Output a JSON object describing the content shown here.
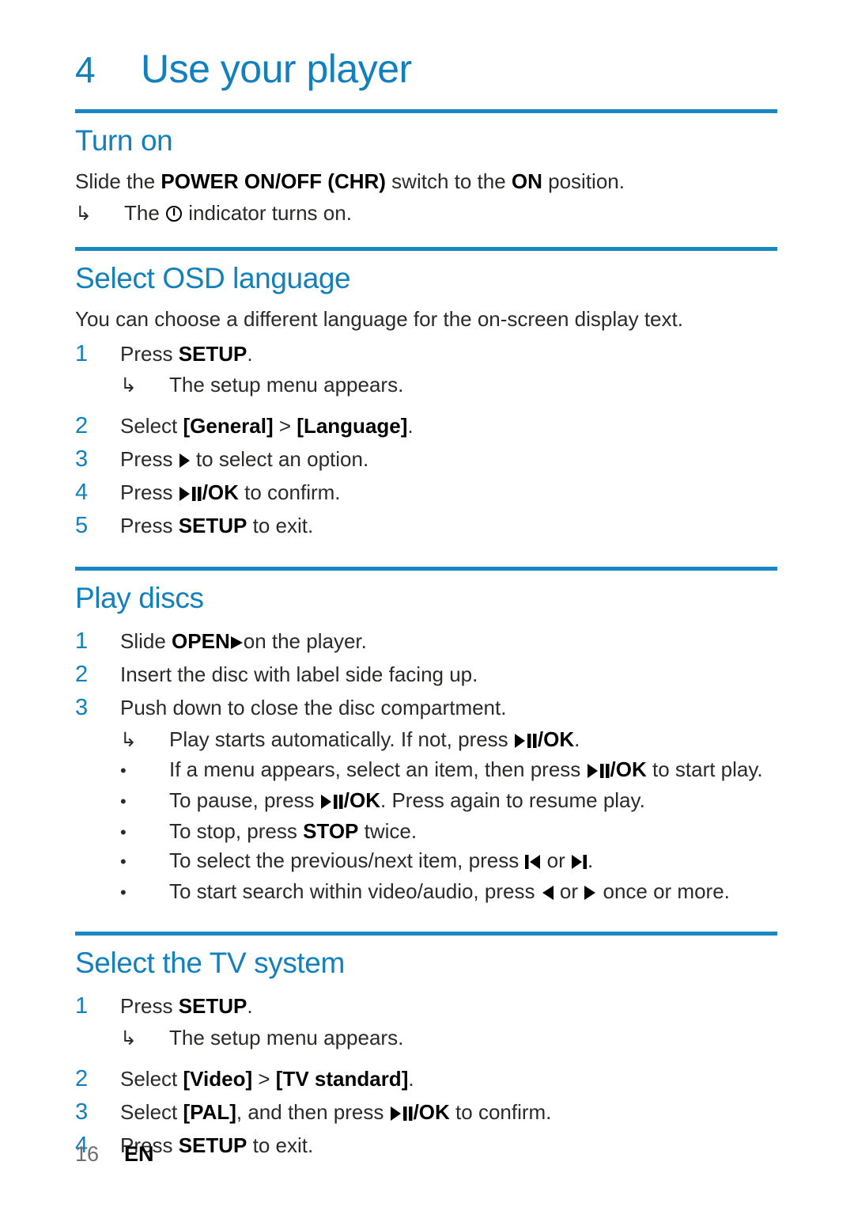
{
  "chapter": {
    "number": "4",
    "title": "Use your player"
  },
  "sections": [
    {
      "heading": "Turn on",
      "intro_prefix": "Slide the ",
      "intro_bold1": "POWER ON/OFF (CHR)",
      "intro_mid": " switch to the ",
      "intro_bold2": "ON",
      "intro_suffix": " position.",
      "result": {
        "pre": "The ",
        "post": " indicator turns on.",
        "icon": "power-standby-icon"
      }
    },
    {
      "heading": "Select OSD language",
      "intro": "You can choose a different language for the on-screen display text.",
      "steps": [
        {
          "num": "1",
          "pre": "Press ",
          "bold": "SETUP",
          "post": "."
        },
        {
          "num": "2",
          "pre": "Select ",
          "bold": "[General]",
          "mid": " > ",
          "bold2": "[Language]",
          "post": "."
        },
        {
          "num": "3",
          "pre": "Press ",
          "icon": "play-triangle-icon",
          "post": " to select an option."
        },
        {
          "num": "4",
          "pre": "Press ",
          "icon": "play-pause-ok-icon",
          "post": " to confirm."
        },
        {
          "num": "5",
          "pre": "Press ",
          "bold": "SETUP",
          "post": " to exit."
        }
      ],
      "step1_result": "The setup menu appears."
    },
    {
      "heading": "Play discs",
      "steps": [
        {
          "num": "1",
          "pre": "Slide ",
          "bold": "OPEN",
          "icon": "open-triangle-icon",
          "post": "on the player."
        },
        {
          "num": "2",
          "pre": "Insert the disc with label side facing up."
        },
        {
          "num": "3",
          "pre": "Push down to close the disc compartment."
        }
      ],
      "step3_result": {
        "pre": "Play starts automatically. If not, press ",
        "icon": "play-pause-ok-icon",
        "post": "."
      },
      "bullets": [
        {
          "pre": "If a menu appears, select an item, then press ",
          "icon": "play-pause-ok-icon",
          "post": " to start play."
        },
        {
          "pre": "To pause, press ",
          "icon": "play-pause-ok-icon",
          "post": ". Press again to resume play."
        },
        {
          "pre": "To stop, press ",
          "bold": "STOP",
          "post": " twice."
        },
        {
          "pre": "To select the previous/next item, press ",
          "icon": "prev-track-icon",
          "mid": " or ",
          "icon2": "next-track-icon",
          "post": "."
        },
        {
          "pre": "To start search within video/audio, press ",
          "icon": "rewind-triangle-icon",
          "mid": " or ",
          "icon2": "forward-triangle-icon",
          "post": " once or more."
        }
      ]
    },
    {
      "heading": "Select the TV system",
      "steps": [
        {
          "num": "1",
          "pre": "Press ",
          "bold": "SETUP",
          "post": "."
        },
        {
          "num": "2",
          "pre": "Select ",
          "bold": "[Video]",
          "mid": " > ",
          "bold2": "[TV standard]",
          "post": "."
        },
        {
          "num": "3",
          "pre": "Select ",
          "bold": "[PAL]",
          "mid": ", and then press ",
          "icon": "play-pause-ok-icon",
          "post": " to confirm."
        },
        {
          "num": "4",
          "pre": "Press ",
          "bold": "SETUP",
          "post": " to exit."
        }
      ],
      "step1_result": "The setup menu appears."
    }
  ],
  "footer": {
    "page_number": "16",
    "language": "EN"
  },
  "colors": {
    "accent_blue": "#1180bd",
    "rule_blue": "#1887c4",
    "body_text": "#2b2a29",
    "footer_page": "#6d6e71"
  },
  "glyphs": {
    "arrow_result": "↳",
    "bullet_dot": "•",
    "gt": ">"
  }
}
